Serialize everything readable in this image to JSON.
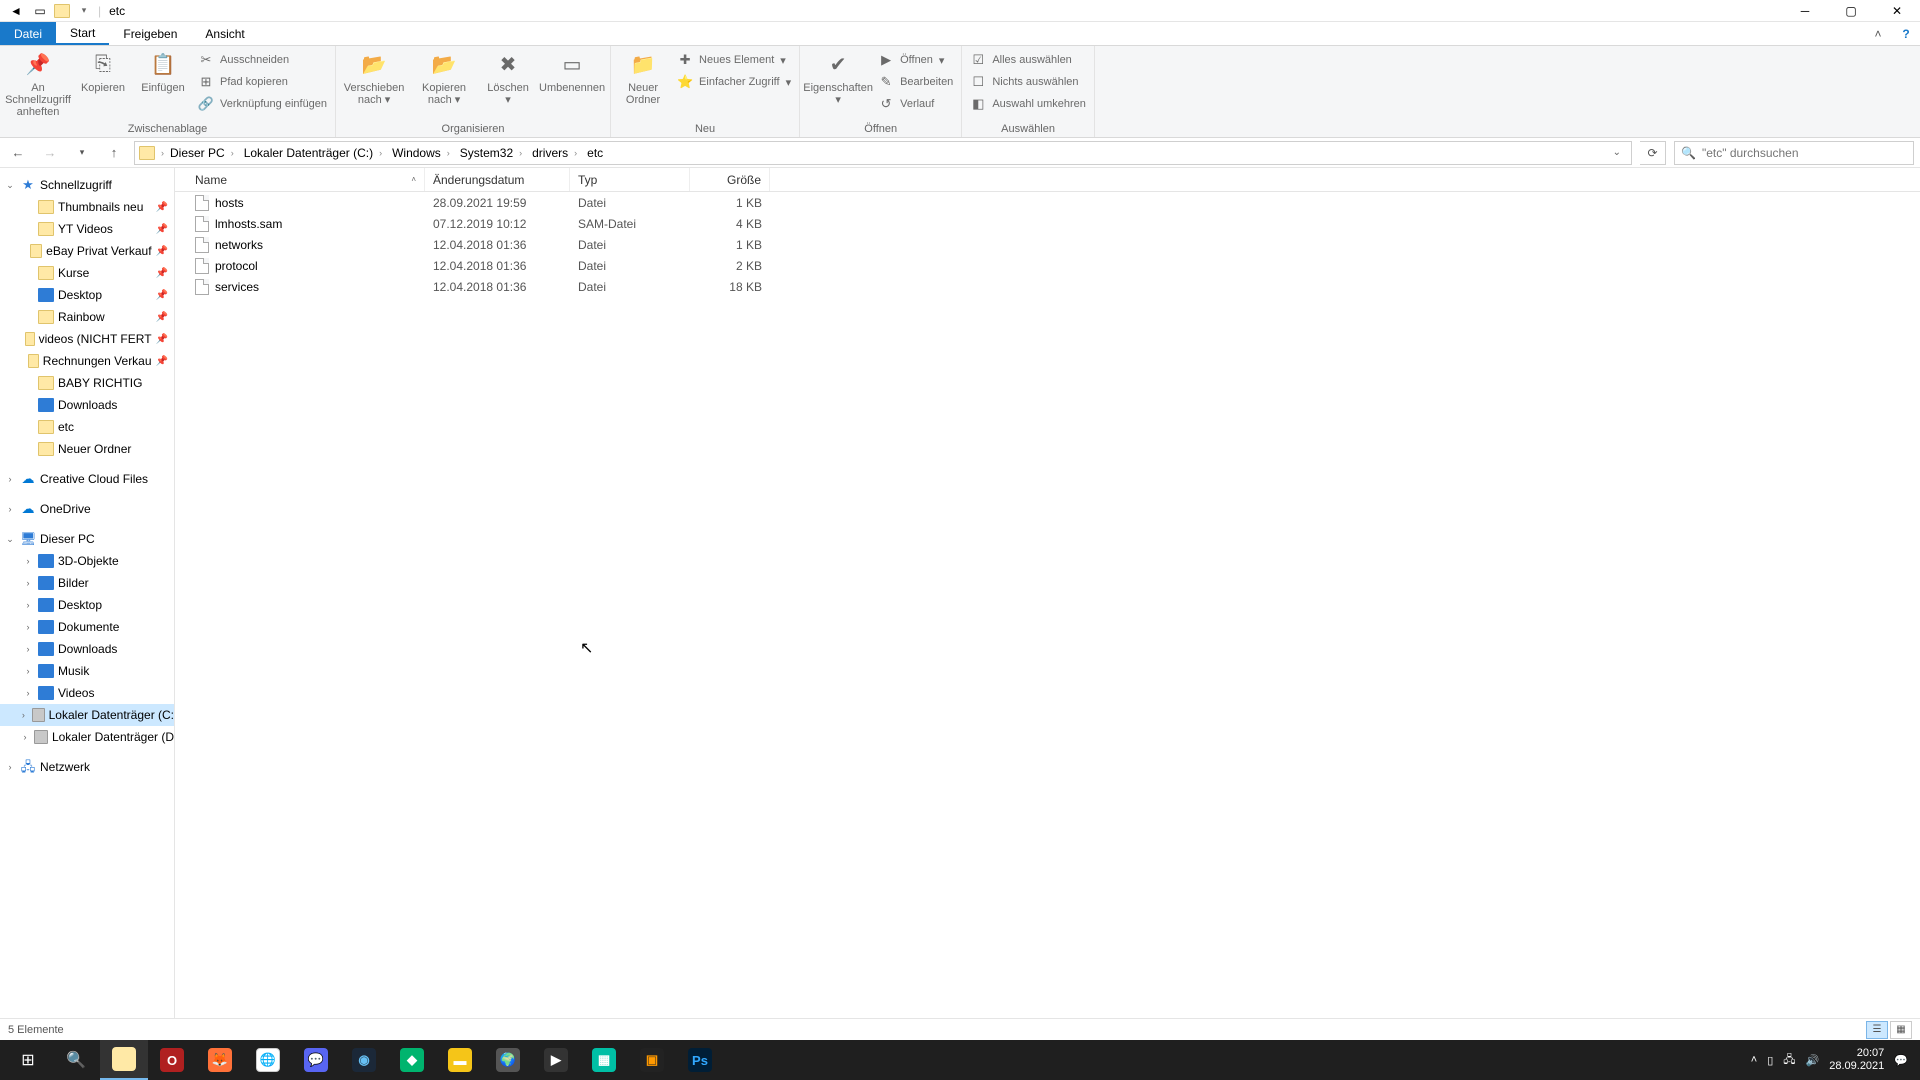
{
  "title": "etc",
  "tabs": {
    "file": "Datei",
    "start": "Start",
    "share": "Freigeben",
    "view": "Ansicht"
  },
  "ribbon": {
    "clipboard": {
      "pin": "An Schnellzugriff anheften",
      "copy": "Kopieren",
      "paste": "Einfügen",
      "cut": "Ausschneiden",
      "copypath": "Pfad kopieren",
      "pastelink": "Verknüpfung einfügen",
      "label": "Zwischenablage"
    },
    "organize": {
      "moveto": "Verschieben nach",
      "copyto": "Kopieren nach",
      "delete": "Löschen",
      "rename": "Umbenennen",
      "label": "Organisieren"
    },
    "new": {
      "newfolder": "Neuer Ordner",
      "newitem": "Neues Element",
      "easyaccess": "Einfacher Zugriff",
      "label": "Neu"
    },
    "open": {
      "properties": "Eigenschaften",
      "open": "Öffnen",
      "edit": "Bearbeiten",
      "history": "Verlauf",
      "label": "Öffnen"
    },
    "select": {
      "selectall": "Alles auswählen",
      "selectnone": "Nichts auswählen",
      "invert": "Auswahl umkehren",
      "label": "Auswählen"
    }
  },
  "breadcrumbs": [
    "Dieser PC",
    "Lokaler Datenträger (C:)",
    "Windows",
    "System32",
    "drivers",
    "etc"
  ],
  "search_placeholder": "\"etc\" durchsuchen",
  "columns": {
    "name": "Name",
    "date": "Änderungsdatum",
    "type": "Typ",
    "size": "Größe"
  },
  "files": [
    {
      "name": "hosts",
      "date": "28.09.2021 19:59",
      "type": "Datei",
      "size": "1 KB"
    },
    {
      "name": "lmhosts.sam",
      "date": "07.12.2019 10:12",
      "type": "SAM-Datei",
      "size": "4 KB"
    },
    {
      "name": "networks",
      "date": "12.04.2018 01:36",
      "type": "Datei",
      "size": "1 KB"
    },
    {
      "name": "protocol",
      "date": "12.04.2018 01:36",
      "type": "Datei",
      "size": "2 KB"
    },
    {
      "name": "services",
      "date": "12.04.2018 01:36",
      "type": "Datei",
      "size": "18 KB"
    }
  ],
  "nav": {
    "quickaccess": "Schnellzugriff",
    "qa": [
      "Thumbnails neu",
      "YT Videos",
      "eBay Privat Verkauf",
      "Kurse",
      "Desktop",
      "Rainbow",
      "videos (NICHT FERT",
      "Rechnungen Verkau",
      "BABY RICHTIG",
      "Downloads",
      "etc",
      "Neuer Ordner"
    ],
    "creativecloud": "Creative Cloud Files",
    "onedrive": "OneDrive",
    "thispc": "Dieser PC",
    "pc": [
      "3D-Objekte",
      "Bilder",
      "Desktop",
      "Dokumente",
      "Downloads",
      "Musik",
      "Videos"
    ],
    "drivec": "Lokaler Datenträger (C:",
    "drived": "Lokaler Datenträger (D",
    "network": "Netzwerk"
  },
  "status": "5 Elemente",
  "tray": {
    "time": "20:07",
    "date": "28.09.2021"
  }
}
